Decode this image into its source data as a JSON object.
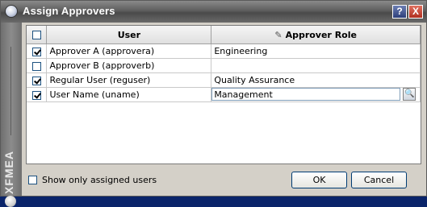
{
  "window": {
    "title": "Assign Approvers",
    "help_icon": "?",
    "close_icon": "X",
    "side_logo": "XFMEA"
  },
  "grid": {
    "columns": {
      "select_all": "",
      "user": "User",
      "role": "Approver Role",
      "role_icon": "✎"
    },
    "rows": [
      {
        "checked": true,
        "user": "Approver A (approvera)",
        "role": "Engineering"
      },
      {
        "checked": false,
        "user": "Approver B (approverb)",
        "role": ""
      },
      {
        "checked": true,
        "user": "Regular User (reguser)",
        "role": "Quality Assurance"
      },
      {
        "checked": true,
        "user": "User Name (uname)",
        "role": "Management",
        "editing": true
      }
    ],
    "lookup_icon": "🔍"
  },
  "footer": {
    "show_assigned_label": "Show only assigned users",
    "ok_label": "OK",
    "cancel_label": "Cancel"
  }
}
